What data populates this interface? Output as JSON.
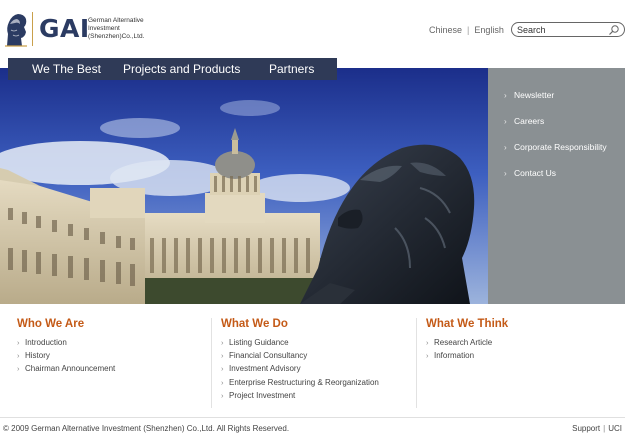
{
  "header": {
    "logo_text": "GAI",
    "logo_sub": [
      "German Alternative",
      "Investment",
      "(Shenzhen)Co.,Ltd."
    ],
    "languages": [
      "Chinese",
      "English"
    ],
    "search": {
      "value": "Search",
      "icon": "search-icon"
    }
  },
  "topnav": {
    "items": [
      "We The Best",
      "Projects and Products",
      "Partners"
    ]
  },
  "side": {
    "links": [
      "Newsletter",
      "Careers",
      "Corporate Responsibility",
      "Contact Us"
    ],
    "arrow": "›"
  },
  "sections": [
    {
      "title": "Who We Are",
      "links": [
        "Introduction",
        "History",
        "Chairman Announcement"
      ]
    },
    {
      "title": "What We Do",
      "links": [
        "Listing Guidance",
        "Financial Consultancy",
        "Investment Advisory",
        "Enterprise Restructuring & Reorganization",
        "Project Investment"
      ]
    },
    {
      "title": "What We Think",
      "links": [
        "Research Article",
        "Information"
      ]
    }
  ],
  "footer": {
    "copyright": "© 2009 German Alternative Investment (Shenzhen) Co.,Ltd. All Rights Reserved.",
    "links": [
      "Support",
      "UCI"
    ]
  },
  "colors": {
    "nav_bg": "#2f3a57",
    "side_bg": "#8a9093",
    "section_title": "#c45a17",
    "logo_text": "#2b3b62",
    "logo_gold": "#c9a04b"
  }
}
